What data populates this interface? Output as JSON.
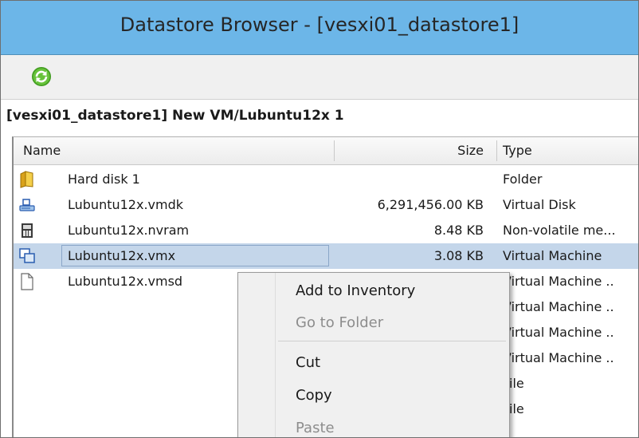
{
  "window": {
    "title": "Datastore Browser - [vesxi01_datastore1]"
  },
  "toolbar": {
    "refresh_icon": "refresh-icon"
  },
  "path": "[vesxi01_datastore1] New VM/Lubuntu12x 1",
  "columns": {
    "name": "Name",
    "size": "Size",
    "type": "Type"
  },
  "files": [
    {
      "name": "Hard disk 1",
      "size": "",
      "type": "Folder",
      "icon": "folder-icon"
    },
    {
      "name": "Lubuntu12x.vmdk",
      "size": "6,291,456.00 KB",
      "type": "Virtual Disk",
      "icon": "virtual-disk-icon"
    },
    {
      "name": "Lubuntu12x.nvram",
      "size": "8.48 KB",
      "type": "Non-volatile me...",
      "icon": "nvram-icon"
    },
    {
      "name": "Lubuntu12x.vmx",
      "size": "3.08 KB",
      "type": "Virtual Machine",
      "icon": "virtual-machine-icon"
    },
    {
      "name": "Lubuntu12x.vmsd",
      "size": "",
      "type": "Virtual Machine ..",
      "icon": "file-icon"
    },
    {
      "name": "",
      "size": "",
      "type": "Virtual Machine ..",
      "icon": ""
    },
    {
      "name": "",
      "size": "",
      "type": "Virtual Machine ..",
      "icon": ""
    },
    {
      "name": "",
      "size": "",
      "type": "Virtual Machine ..",
      "icon": ""
    },
    {
      "name": "",
      "size": "",
      "type": "File",
      "icon": ""
    },
    {
      "name": "",
      "size": "",
      "type": "File",
      "icon": ""
    }
  ],
  "context_menu": {
    "items": [
      {
        "label": "Add to Inventory",
        "enabled": true
      },
      {
        "label": "Go to Folder",
        "enabled": false
      },
      {
        "label": "Cut",
        "enabled": true
      },
      {
        "label": "Copy",
        "enabled": true
      },
      {
        "label": "Paste",
        "enabled": false
      }
    ]
  },
  "colors": {
    "titlebar": "#6cb6e8",
    "selection": "#c4d6ea",
    "menu_background": "#f0f0f0",
    "disabled_text": "#8d8d8d"
  }
}
